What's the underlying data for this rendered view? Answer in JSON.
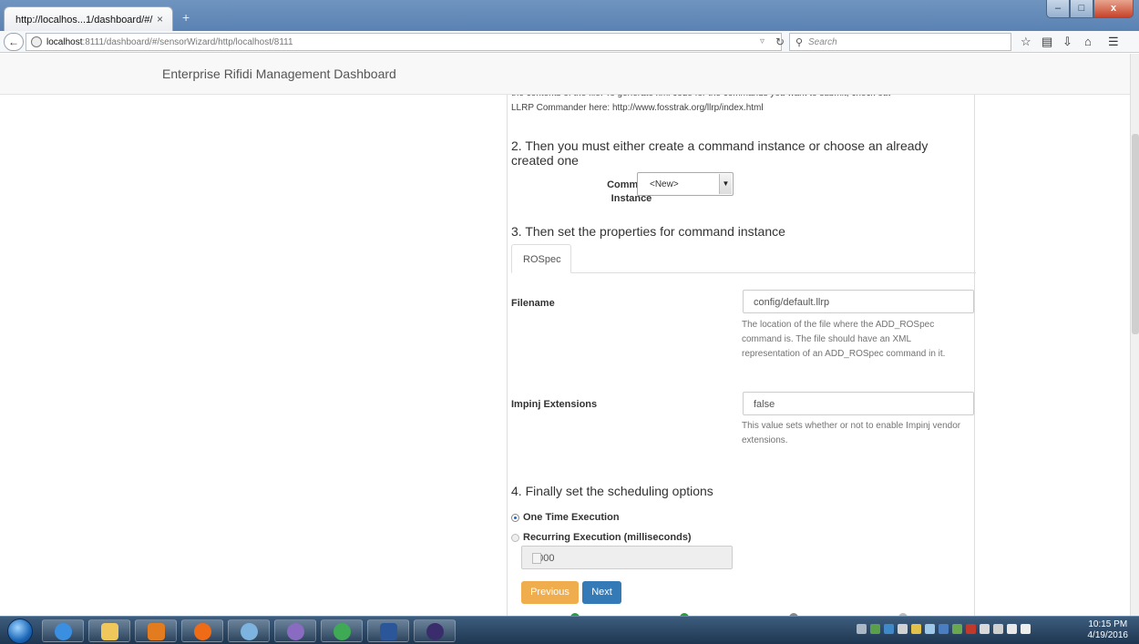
{
  "browser": {
    "tab_title": "http://localhos...1/dashboard/#/",
    "tab_close": "×",
    "new_tab": "+",
    "url_host": "localhost",
    "url_rest": ":8111/dashboard/#/sensorWizard/http/localhost/8111",
    "search_placeholder": "Search",
    "window_buttons": {
      "minimize": "–",
      "maximize": "□",
      "close": "x"
    }
  },
  "app": {
    "brand": "Enterprise Rifidi Management Dashboard"
  },
  "wizard": {
    "intro_line1": "the contents of the file. To generate xml code for the commands you want to submit, check out",
    "intro_line2": "LLRP Commander here: http://www.fosstrak.org/llrp/index.html",
    "step2_title": "2. Then you must either create a command instance or choose an already created one",
    "command_instance_label": "Command Instance",
    "command_instance_value": "<New>",
    "step3_title": "3. Then set the properties for command instance",
    "tabs": [
      {
        "label": "ROSpec"
      }
    ],
    "properties": [
      {
        "label": "Filename",
        "value": "config/default.llrp",
        "help": "The location of the file where the ADD_ROSpec command is. The file should have an XML representation of an ADD_ROSpec command in it."
      },
      {
        "label": "Impinj Extensions",
        "value": "false",
        "help": "This value sets whether or not to enable Impinj vendor extensions."
      }
    ],
    "step4_title": "4. Finally set the scheduling options",
    "schedule": {
      "one_time_label": "One Time Execution",
      "recurring_label": "Recurring Execution (milliseconds)",
      "interval_value": "1000",
      "selected": "one_time"
    },
    "buttons": {
      "previous": "Previous",
      "next": "Next"
    }
  },
  "colors": {
    "btn_previous": "#f0ad4e",
    "btn_next": "#337ab7",
    "progress_done": "#21a336",
    "progress_todo": "#888888"
  },
  "taskbar": {
    "apps": [
      "internet-explorer-icon",
      "file-explorer-icon",
      "media-player-icon",
      "firefox-icon",
      "vpn-icon",
      "messenger-icon",
      "chrome-icon",
      "word-icon",
      "eclipse-icon"
    ],
    "clock_time": "10:15 PM",
    "clock_date": "4/19/2016"
  }
}
